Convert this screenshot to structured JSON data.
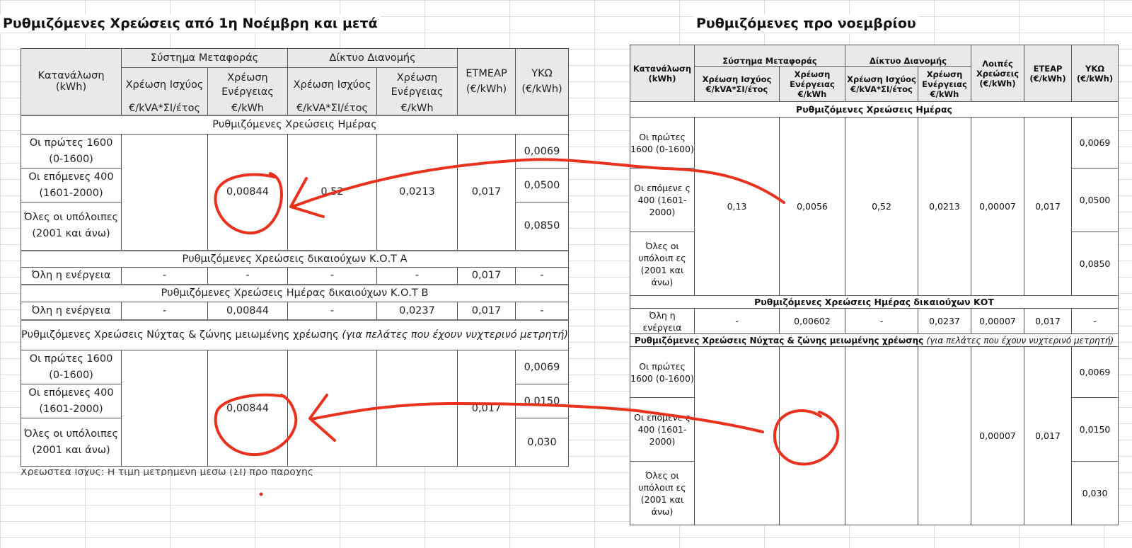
{
  "left": {
    "title": "Ρυθμιζόμενες Χρεώσεις από 1η Νοέμβρη και μετά",
    "headers": {
      "consumption": "Κατανάλωση",
      "consumption_unit": "(kWh)",
      "transmission": "Σύστημα Μεταφοράς",
      "distribution": "Δίκτυο Διανομής",
      "power_charge": "Χρέωση Ισχύος",
      "energy_charge": "Χρέωση Ενέργειας",
      "unit_power": "€/kVA*ΣΙ/έτος",
      "unit_energy": "€/kWh",
      "etmear": "ΕΤΜΕΑΡ",
      "etmear_unit": "(€/kWh)",
      "yko": "ΥΚΩ",
      "yko_unit": "(€/kWh)"
    },
    "group_day": "Ρυθμιζόμενες Χρεώσεις Ημέρας",
    "tiers": [
      "Οι πρώτες 1600 (0-1600)",
      "Οι επόμενες 400 (1601-2000)",
      "Όλες οι υπόλοιπες (2001 και άνω)"
    ],
    "day_values": {
      "ts_energy": "0,00844",
      "dn_power": "0,52",
      "dn_energy": "0,0213",
      "etmear": "0,017",
      "yko": [
        "0,0069",
        "0,0500",
        "0,0850"
      ]
    },
    "group_kot_a": "Ρυθμιζόμενες Χρεώσεις δικαιούχων Κ.Ο.Τ Α",
    "kot_a_row": {
      "label": "Όλη η ενέργεια",
      "ts_power": "-",
      "ts_energy": "-",
      "dn_power": "-",
      "dn_energy": "-",
      "etmear": "0,017",
      "yko": "-"
    },
    "group_kot_b": "Ρυθμιζόμενες Χρεώσεις Ημέρας δικαιούχων Κ.Ο.Τ Β",
    "kot_b_row": {
      "label": "Όλη η ενέργεια",
      "ts_power": "-",
      "ts_energy": "0,00844",
      "dn_power": "-",
      "dn_energy": "0,0237",
      "etmear": "0,017",
      "yko": "-"
    },
    "group_night": "Ρυθμιζόμενες Χρεώσεις Νύχτας & ζώνης μειωμένης χρέωσης",
    "group_night_note": "(για πελάτες που έχουν νυχτερινό μετρητή)",
    "night_values": {
      "ts_energy": "0,00844",
      "etmear": "0,017",
      "yko": [
        "0,0069",
        "0,0150",
        "0,030"
      ]
    },
    "cut_text": "Χρεωστέα Ισχύς: Η τιμή μετρημένη μέσω (ΣΙ) προ παροχής"
  },
  "right": {
    "title": "Ρυθμιζόμενες προ νοεμβρίου",
    "headers": {
      "consumption": "Κατανάλωση (kWh)",
      "transmission": "Σύστημα Μεταφοράς",
      "distribution": "Δίκτυο Διανομής",
      "ts_power": "Χρέωση Ισχύος €/kVA*ΣΙ/έτος",
      "ts_energy": "Χρέωση Ενέργειας €/kWh",
      "dn_power": "Χρέωση Ισχύος €/kVA*ΣΙ/έτος",
      "dn_energy": "Χρέωση Ενέργειας €/kWh",
      "other": "Λοιπές Χρεώσεις (€/kWh)",
      "etear": "ΕΤΕΑΡ (€/kWh)",
      "yko": "ΥΚΩ (€/kWh)"
    },
    "group_day": "Ρυθμιζόμενες Χρεώσεις Ημέρας",
    "tiers": [
      "Οι πρώτες 1600 (0-1600)",
      "Οι επόμενε ς 400 (1601-2000)",
      "Όλες οι υπόλοιπ ες (2001 και άνω)"
    ],
    "day_values": {
      "ts_power": "0,13",
      "ts_energy": "0,0056",
      "dn_power": "0,52",
      "dn_energy": "0,0213",
      "other": "0,00007",
      "etear": "0,017",
      "yko": [
        "0,0069",
        "0,0500",
        "0,0850"
      ]
    },
    "group_kot": "Ρυθμιζόμενες Χρεώσεις Ημέρας δικαιούχων ΚΟΤ",
    "kot_row": {
      "label": "Όλη η ενέργεια",
      "ts_power": "-",
      "ts_energy": "0,00602",
      "dn_power": "-",
      "dn_energy": "0,0237",
      "other": "0,00007",
      "etear": "0,017",
      "yko": "-"
    },
    "group_night": "Ρυθμιζόμενες Χρεώσεις Νύχτας & ζώνης μειωμένης χρέωσης",
    "group_night_note": "(για πελάτες που έχουν νυχτερινό μετρητή)",
    "night_values": {
      "other": "0,00007",
      "etear": "0,017",
      "yko": [
        "0,0069",
        "0,0150",
        "0,030"
      ]
    }
  },
  "annotation": {
    "color": "#e8321e"
  }
}
